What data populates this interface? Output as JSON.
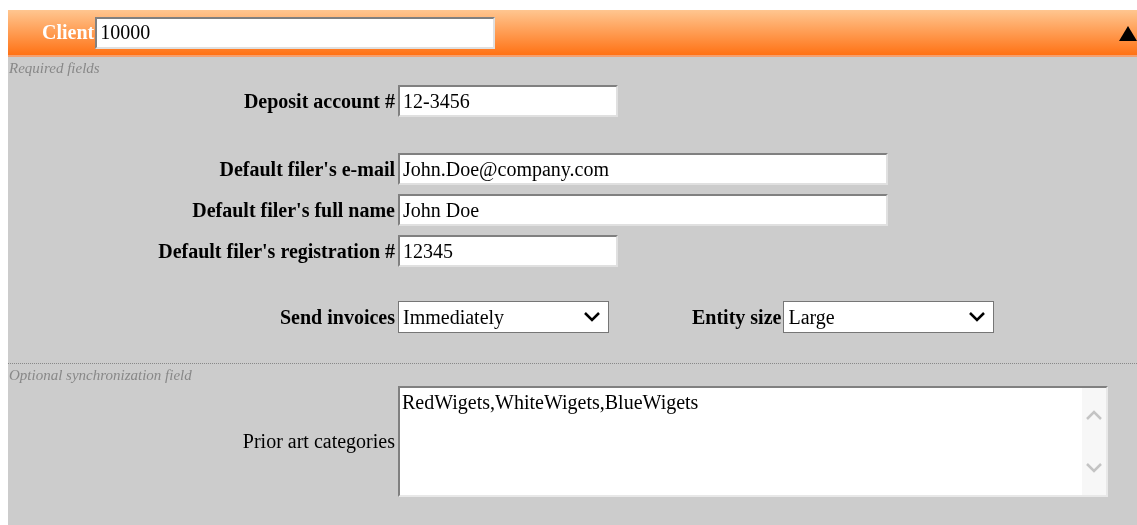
{
  "header": {
    "label": "Client",
    "value": "10000",
    "collapsed": false
  },
  "required_section": {
    "caption": "Required fields",
    "fields": [
      {
        "label": "Deposit account #",
        "value": "12-3456",
        "kind": "short"
      },
      {
        "label": "Default filer's e-mail",
        "value": "John.Doe@company.com",
        "kind": "long"
      },
      {
        "label": "Default filer's full name",
        "value": "John Doe",
        "kind": "long"
      },
      {
        "label": "Default filer's registration #",
        "value": "12345",
        "kind": "short"
      }
    ],
    "selects": [
      {
        "label": "Send invoices",
        "value": "Immediately"
      },
      {
        "label": "Entity size",
        "value": "Large"
      }
    ]
  },
  "optional_section": {
    "caption": "Optional synchronization field",
    "textarea": {
      "label": "Prior art categories",
      "value": "RedWigets,WhiteWigets,BlueWigets"
    }
  }
}
